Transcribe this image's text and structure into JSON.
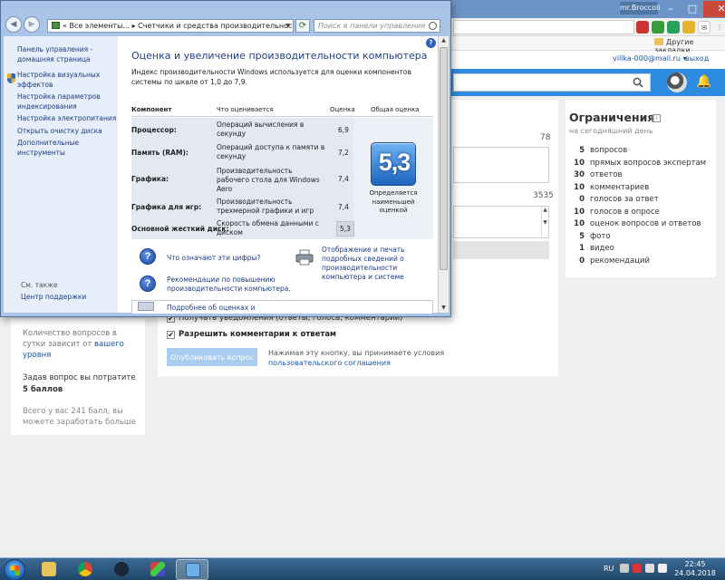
{
  "browser": {
    "profile_label": "mr.Broccoli",
    "bookmarks": {
      "other": "Другие закладки"
    },
    "account": {
      "email": "villka-000@mail.ru ▾",
      "logout": "выход"
    }
  },
  "form": {
    "counter_1": "78",
    "counter_2": "3535",
    "notify_label": "Получать уведомления (ответы, голоса, комментарии)",
    "allow_comments_label": "Разрешить комментарии к ответам",
    "publish_button": "Опубликовать вопрос",
    "publish_note": "Нажимая эту кнопку, вы принимаете условия",
    "agreement_link": "пользовательского соглашения"
  },
  "limits": {
    "title": "Ограничения",
    "subtitle": "на сегодняшний день",
    "items": [
      {
        "count": "5",
        "label": "вопросов"
      },
      {
        "count": "10",
        "label": "прямых вопросов экспертам"
      },
      {
        "count": "30",
        "label": "ответов"
      },
      {
        "count": "10",
        "label": "комментариев"
      },
      {
        "count": "0",
        "label": "голосов за ответ"
      },
      {
        "count": "10",
        "label": "голосов в опросе"
      },
      {
        "count": "10",
        "label": "оценок вопросов и ответов"
      },
      {
        "count": "5",
        "label": "фото"
      },
      {
        "count": "1",
        "label": "видео"
      },
      {
        "count": "0",
        "label": "рекомендаций"
      }
    ]
  },
  "left_panel": {
    "text1": "Количество вопросов в сутки зависит от",
    "text1_link": "вашего уровня",
    "text2": "Задав вопрос вы потратите",
    "text2_bold": "5 баллов",
    "text3": "Всего у вас 241 балл, вы можете заработать больше"
  },
  "window": {
    "address_parts": [
      "«",
      "Все элементы...",
      "▸",
      "Счетчики и средства производительности",
      "▸"
    ],
    "search_placeholder": "Поиск в панели управления",
    "sidebar": {
      "links": [
        "Панель управления - домашняя страница",
        "Настройка визуальных эффектов",
        "Настройка параметров индексирования",
        "Настройка электропитания",
        "Открыть очистку диска",
        "Дополнительные инструменты"
      ],
      "see_also": "См. также",
      "support": "Центр поддержки"
    },
    "title": "Оценка и увеличение производительности компьютера",
    "description": "Индекс производительности Windows используется для оценки компонентов системы по шкале от 1,0 до 7,9.",
    "table_headers": [
      "Компонент",
      "Что оценивается",
      "Оценка",
      "Общая оценка"
    ],
    "rows": [
      {
        "component": "Процессор:",
        "desc": "Операций вычисления в секунду",
        "score": "6,9"
      },
      {
        "component": "Память (RAM):",
        "desc": "Операций доступа к памяти в секунду",
        "score": "7,2"
      },
      {
        "component": "Графика:",
        "desc": "Производительность рабочего стола для Windows Aero",
        "score": "7,4"
      },
      {
        "component": "Графика для игр:",
        "desc": "Производительность трехмерной графики и игр",
        "score": "7,4"
      },
      {
        "component": "Основной жесткий диск:",
        "desc": "Скорость обмена данными с диском",
        "score": "5,3"
      }
    ],
    "base_score": "5,3",
    "base_score_caption": "Определяется наименьшей оценкой",
    "link_what_mean": "Что означают эти цифры?",
    "link_recs": "Рекомендации по повышению производительности компьютера.",
    "link_print": "Отображение и печать подробных сведений о производительности компьютера и системе",
    "link_more": "Подробнее об оценках и"
  },
  "taskbar": {
    "lang": "RU",
    "time": "22:45",
    "date": "24.04.2018"
  },
  "colors": {
    "accent_blue": "#2e8ce0",
    "link_blue": "#1a56a6",
    "win_frame": "#a9c4e6"
  }
}
